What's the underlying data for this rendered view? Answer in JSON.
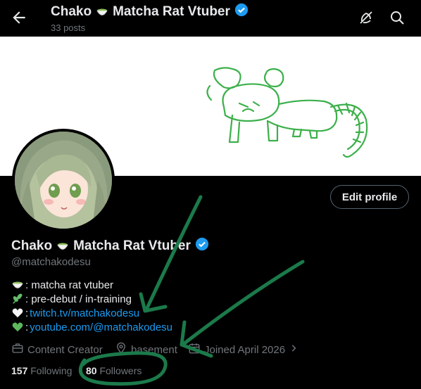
{
  "header": {
    "name": "Chako",
    "name_suffix": "Matcha Rat Vtuber",
    "posts": "33 posts"
  },
  "icons": {
    "back": "arrow-left-icon",
    "no_notify": "bell-slash-icon",
    "search": "search-icon",
    "verified": "verified-badge-icon",
    "matcha": "matcha-bowl-icon"
  },
  "profile": {
    "display_name": "Chako",
    "display_suffix": "Matcha Rat Vtuber",
    "handle": "@matchakodesu",
    "edit_label": "Edit profile",
    "bio": [
      {
        "emoji": "matcha-bowl-icon",
        "text": ": matcha rat vtuber"
      },
      {
        "emoji": "herb-icon",
        "text": ": pre-debut / in-training"
      },
      {
        "emoji": "white-heart-icon",
        "text": ":",
        "link": "twitch.tv/matchakodesu"
      },
      {
        "emoji": "green-heart-icon",
        "text": ":",
        "link": "youtube.com/@matchakodesu"
      }
    ],
    "meta": {
      "category": "Content Creator",
      "location": "basement",
      "joined": "Joined April 2026"
    },
    "stats": {
      "following_count": "157",
      "following_label": "Following",
      "followers_count": "80",
      "followers_label": "Followers"
    }
  },
  "colors": {
    "background": "#000000",
    "link": "#1d9bf0",
    "muted": "#71767b",
    "verified": "#1d9bf0",
    "annotation": "#1b7a4a",
    "doodle": "#3cb04a"
  }
}
